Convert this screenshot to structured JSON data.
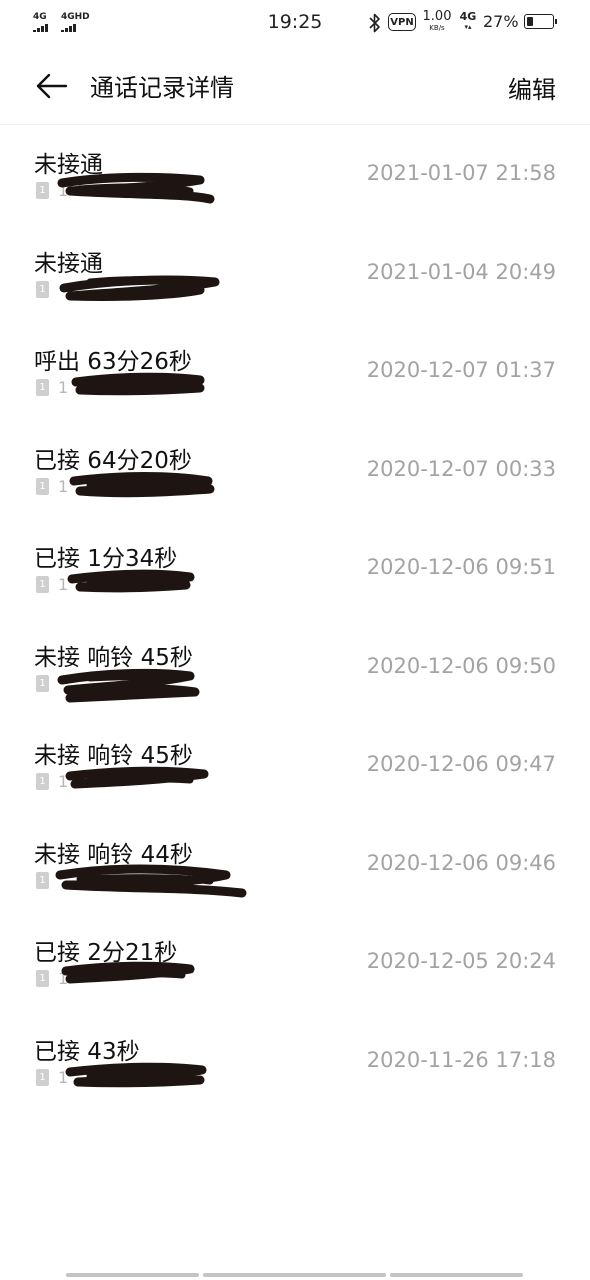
{
  "status_bar": {
    "sim1_label": "4G",
    "sim2_label": "4GHD",
    "time": "19:25",
    "vpn_label": "VPN",
    "speed_value": "1.00",
    "speed_unit": "KB/s",
    "network_label": "4G",
    "battery_percent_text": "27%",
    "battery_level": 0.27
  },
  "header": {
    "title": "通话记录详情",
    "edit_label": "编辑"
  },
  "calls": [
    {
      "type": "未接通",
      "number": "1  0",
      "datetime": "2021-01-07 21:58"
    },
    {
      "type": "未接通",
      "number": "",
      "datetime": "2021-01-04 20:49"
    },
    {
      "type": "呼出 63分26秒",
      "number": "1",
      "datetime": "2020-12-07 01:37"
    },
    {
      "type": "已接 64分20秒",
      "number": "1",
      "datetime": "2020-12-07 00:33"
    },
    {
      "type": "已接 1分34秒",
      "number": "1",
      "datetime": "2020-12-06 09:51"
    },
    {
      "type": "未接 响铃 45秒",
      "number": "",
      "datetime": "2020-12-06 09:50"
    },
    {
      "type": "未接 响铃 45秒",
      "number": "1",
      "datetime": "2020-12-06 09:47"
    },
    {
      "type": "未接 响铃 44秒",
      "number": "",
      "datetime": "2020-12-06 09:46"
    },
    {
      "type": "已接 2分21秒",
      "number": "1",
      "datetime": "2020-12-05 20:24"
    },
    {
      "type": "已接 43秒",
      "number": "1",
      "datetime": "2020-11-26 17:18"
    }
  ],
  "sim_badge_label": "1"
}
